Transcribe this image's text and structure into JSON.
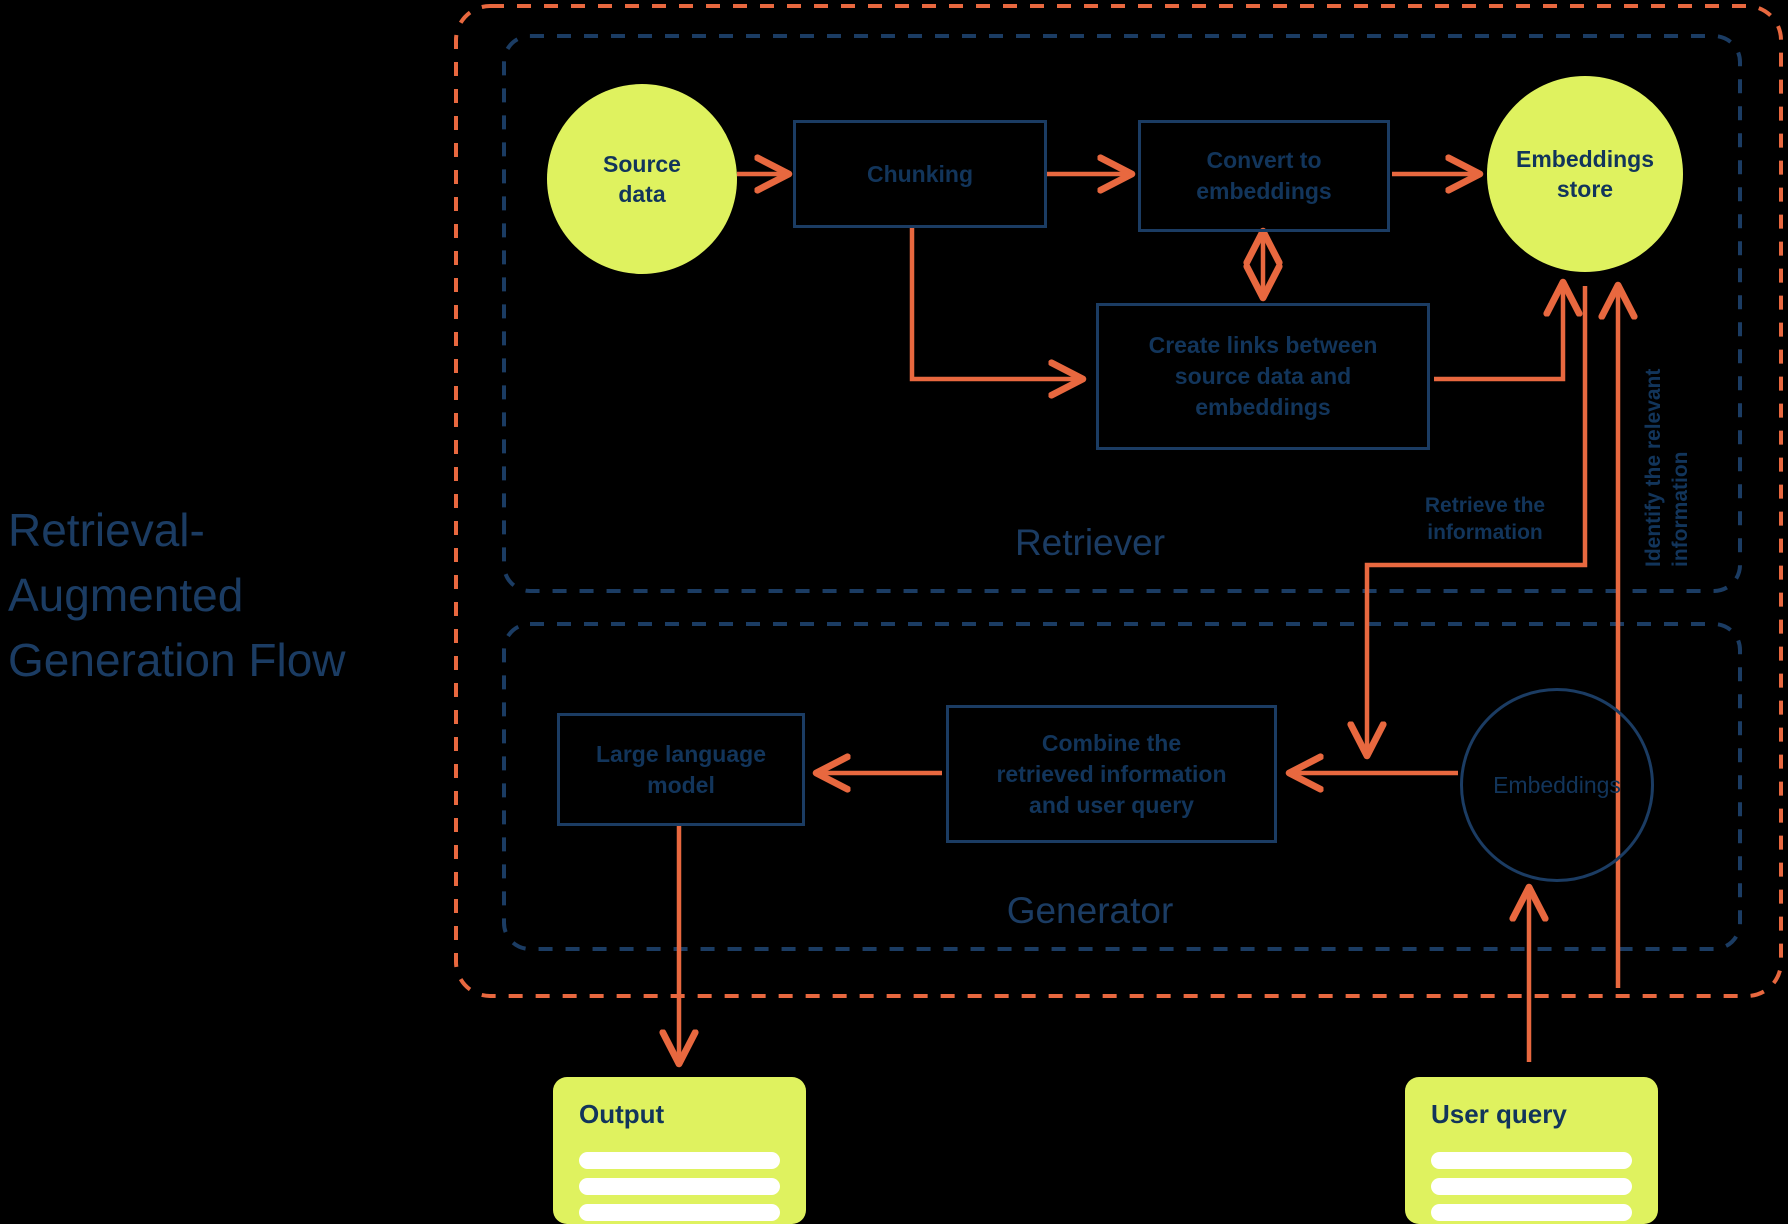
{
  "title": "Retrieval-\nAugmented\nGeneration Flow",
  "colors": {
    "background": "#000000",
    "accent_lime": "#dff25f",
    "navy": "#1b3c63",
    "navy_text": "#12355b",
    "orange": "#e8683f"
  },
  "groups": [
    {
      "name": "outer-group",
      "label": "",
      "style": "dashed-orange"
    },
    {
      "name": "retriever-group",
      "label": "Retriever",
      "style": "dashed-navy"
    },
    {
      "name": "generator-group",
      "label": "Generator",
      "style": "dashed-navy"
    }
  ],
  "retriever": {
    "section_label": "Retriever",
    "nodes": {
      "source_data": "Source\ndata",
      "chunking": "Chunking",
      "convert_to_embeddings": "Convert to\nembeddings",
      "embeddings_store": "Embeddings\nstore",
      "create_links": "Create links between\nsource data and\nembeddings"
    }
  },
  "generator": {
    "section_label": "Generator",
    "nodes": {
      "large_language_model": "Large language\nmodel",
      "combine": "Combine the\nretrieved information\nand user query",
      "embeddings": "Embeddings"
    }
  },
  "edge_labels": {
    "retrieve_information": "Retrieve the\ninformation",
    "identify_relevant": "Identify the relevant\ninformation"
  },
  "cards": [
    {
      "name": "output-card",
      "title": "Output",
      "lines": 3
    },
    {
      "name": "user-query-card",
      "title": "User query",
      "lines": 3
    }
  ]
}
